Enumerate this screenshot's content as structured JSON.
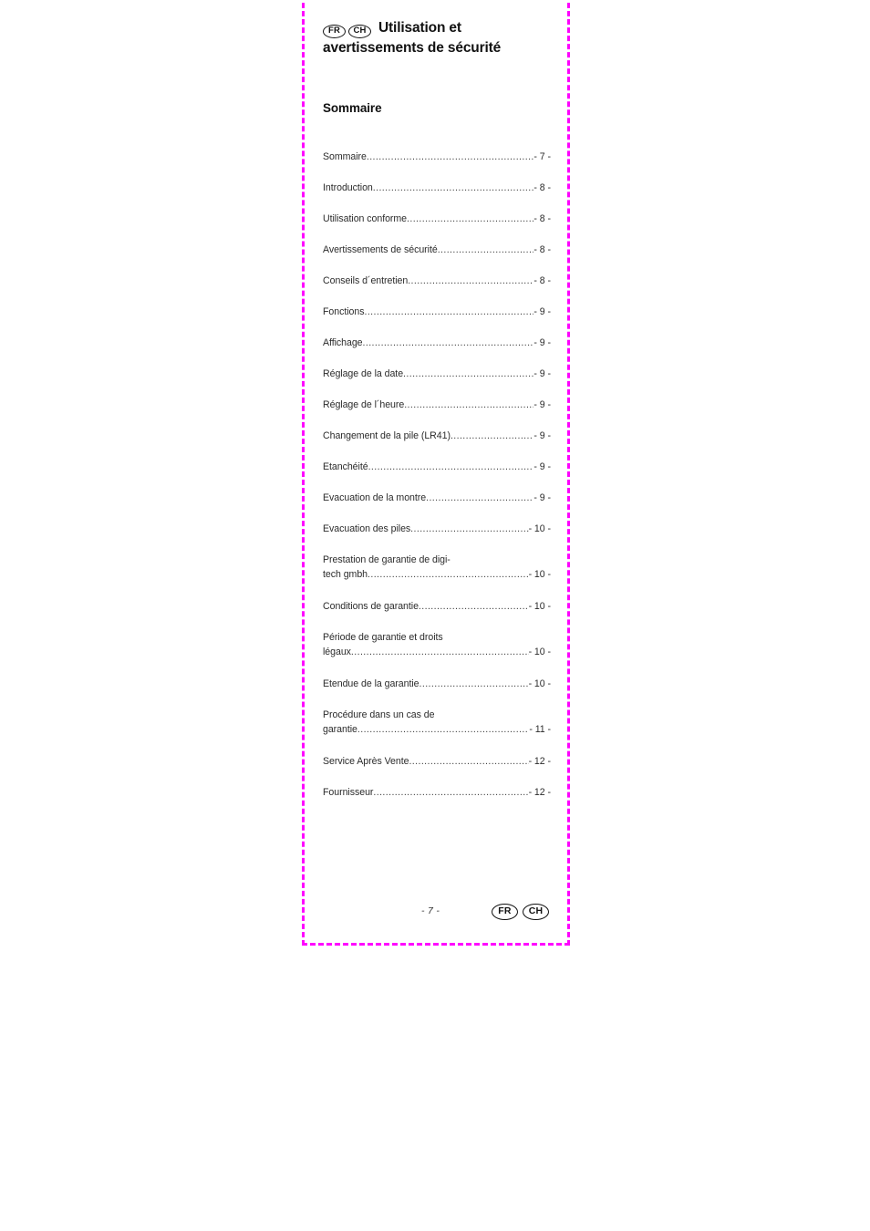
{
  "page": {
    "border_color": "#ff00ff",
    "background": "#ffffff"
  },
  "header": {
    "badges": [
      "FR",
      "CH"
    ],
    "title_line_1": "Utilisation et",
    "title_line_2": "avertissements de sécurité"
  },
  "toc": {
    "heading": "Sommaire",
    "leader": "................................................................................................",
    "entries": [
      {
        "label": "Sommaire",
        "page": "- 7 -"
      },
      {
        "label": "Introduction",
        "page": "- 8 -"
      },
      {
        "label": "Utilisation conforme",
        "page": "- 8 -"
      },
      {
        "label": "Avertissements de sécurité",
        "page": "- 8 -"
      },
      {
        "label": "Conseils d´entretien",
        "page": "- 8 -"
      },
      {
        "label": "Fonctions",
        "page": "- 9 -"
      },
      {
        "label": "Affichage",
        "page": "- 9 -"
      },
      {
        "label": "Réglage de la date",
        "page": "- 9 -"
      },
      {
        "label": "Réglage de l´heure",
        "page": "- 9 -"
      },
      {
        "label": "Changement de la pile (LR41)",
        "page": "- 9 -"
      },
      {
        "label": "Etanchéité",
        "page": "- 9 -"
      },
      {
        "label": "Evacuation de la montre",
        "page": "- 9 -"
      },
      {
        "label": "Evacuation des piles",
        "page": "- 10 -"
      },
      {
        "first_line": "Prestation de garantie de digi-",
        "label": "tech gmbh",
        "page": "- 10 -"
      },
      {
        "label": "Conditions de garantie",
        "page": "- 10 -"
      },
      {
        "first_line": "Période de garantie et droits",
        "label": "légaux",
        "page": "- 10 -"
      },
      {
        "label": "Etendue de la garantie",
        "page": "- 10 -"
      },
      {
        "first_line": "Procédure dans un cas de",
        "label": "garantie",
        "page": "- 11 -"
      },
      {
        "label": "Service Après Vente",
        "page": "- 12 -"
      },
      {
        "label": "Fournisseur",
        "page": "- 12 -"
      }
    ]
  },
  "footer": {
    "page_number": "- 7 -",
    "badges": [
      "FR",
      "CH"
    ]
  }
}
